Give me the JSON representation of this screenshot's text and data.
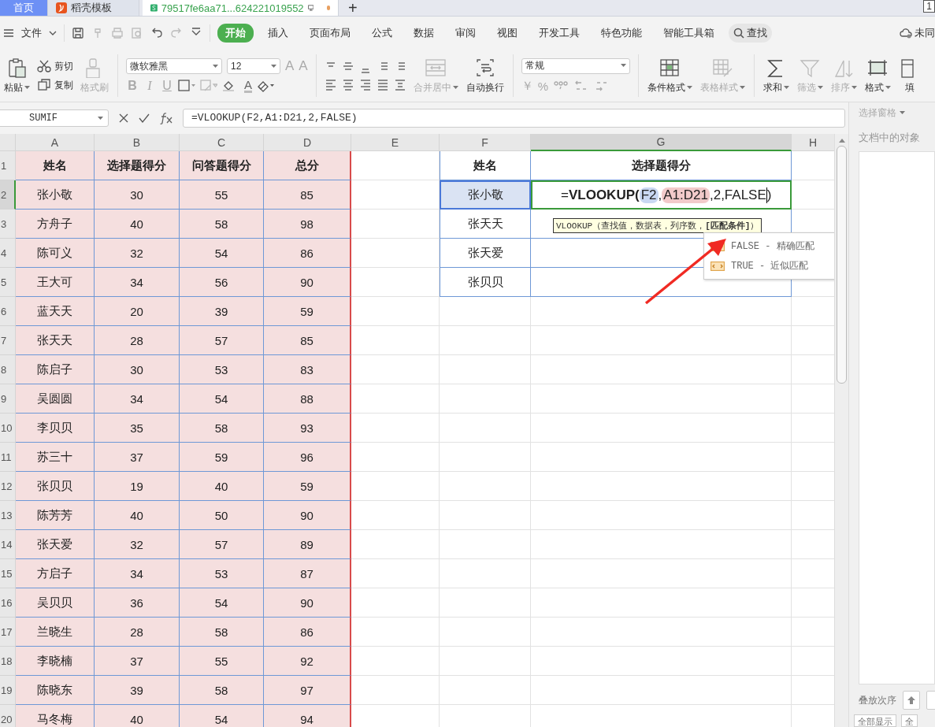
{
  "tabs": [
    {
      "label": "首页",
      "selected": false,
      "kind": "home"
    },
    {
      "label": "稻壳模板",
      "selected": false,
      "kind": "docer"
    },
    {
      "label": "79517fe6aa71...624221019552",
      "selected": true,
      "kind": "sheet",
      "unsaved": true
    }
  ],
  "new_tab": "+",
  "corner_badge": "1",
  "menu": {
    "file": "文件",
    "tabs": [
      {
        "label": "开始",
        "selected": true
      },
      {
        "label": "插入",
        "selected": false
      },
      {
        "label": "页面布局",
        "selected": false
      },
      {
        "label": "公式",
        "selected": false
      },
      {
        "label": "数据",
        "selected": false
      },
      {
        "label": "审阅",
        "selected": false
      },
      {
        "label": "视图",
        "selected": false
      },
      {
        "label": "开发工具",
        "selected": false
      },
      {
        "label": "特色功能",
        "selected": false
      },
      {
        "label": "智能工具箱",
        "selected": false
      }
    ],
    "search": "查找",
    "sync": "未同"
  },
  "ribbon": [
    {
      "kind": "large",
      "label": "粘贴",
      "caret": true,
      "disabled": false
    },
    {
      "kind": "stack",
      "items": [
        {
          "label": "剪切",
          "disabled": false
        },
        {
          "label": "复制",
          "disabled": false
        }
      ]
    },
    {
      "kind": "large",
      "label": "格式刷",
      "caret": false,
      "disabled": true
    },
    {
      "kind": "sep"
    },
    {
      "kind": "font",
      "font": "微软雅黑",
      "size": "12",
      "grow": "A",
      "shrink": "A",
      "styles": [
        "B",
        "I",
        "U"
      ],
      "color_letter": "A"
    },
    {
      "kind": "sep"
    },
    {
      "kind": "align"
    },
    {
      "kind": "large",
      "label": "合并居中",
      "caret": true,
      "disabled": true
    },
    {
      "kind": "large",
      "label": "自动换行",
      "caret": false,
      "disabled": false
    },
    {
      "kind": "sep"
    },
    {
      "kind": "number",
      "format": "常规",
      "currency": "￥",
      "percent": "%"
    },
    {
      "kind": "sep"
    },
    {
      "kind": "large",
      "label": "条件格式",
      "caret": true,
      "disabled": false
    },
    {
      "kind": "large",
      "label": "表格样式",
      "caret": true,
      "disabled": true
    },
    {
      "kind": "sep"
    },
    {
      "kind": "large",
      "label": "求和",
      "caret": true,
      "disabled": false
    },
    {
      "kind": "large",
      "label": "筛选",
      "caret": true,
      "disabled": true
    },
    {
      "kind": "large",
      "label": "排序",
      "caret": true,
      "disabled": true
    },
    {
      "kind": "large",
      "label": "格式",
      "caret": true,
      "disabled": false
    },
    {
      "kind": "large",
      "label": "填",
      "caret": false,
      "disabled": false
    }
  ],
  "formula_bar": {
    "name_box": "SUMIF",
    "formula": "=VLOOKUP(F2,A1:D21,2,FALSE)"
  },
  "columns": [
    {
      "label": "A",
      "selected": false
    },
    {
      "label": "B",
      "selected": false
    },
    {
      "label": "C",
      "selected": false
    },
    {
      "label": "D",
      "selected": false
    },
    {
      "label": "E",
      "selected": false
    },
    {
      "label": "F",
      "selected": false
    },
    {
      "label": "G",
      "selected": true
    },
    {
      "label": "H",
      "selected": false
    }
  ],
  "row_numbers": [
    {
      "label": "1",
      "selected": false
    },
    {
      "label": "2",
      "selected": true
    },
    {
      "label": "3",
      "selected": false
    },
    {
      "label": "4",
      "selected": false
    },
    {
      "label": "5",
      "selected": false
    },
    {
      "label": "6",
      "selected": false
    },
    {
      "label": "7",
      "selected": false
    },
    {
      "label": "8",
      "selected": false
    },
    {
      "label": "9",
      "selected": false
    },
    {
      "label": "10",
      "selected": false
    },
    {
      "label": "11",
      "selected": false
    },
    {
      "label": "12",
      "selected": false
    },
    {
      "label": "13",
      "selected": false
    },
    {
      "label": "14",
      "selected": false
    },
    {
      "label": "15",
      "selected": false
    },
    {
      "label": "16",
      "selected": false
    },
    {
      "label": "17",
      "selected": false
    },
    {
      "label": "18",
      "selected": false
    },
    {
      "label": "19",
      "selected": false
    },
    {
      "label": "20",
      "selected": false
    }
  ],
  "data_table": {
    "header": [
      "姓名",
      "选择题得分",
      "问答题得分",
      "总分"
    ],
    "rows": [
      [
        "张小敬",
        "30",
        "55",
        "85"
      ],
      [
        "方舟子",
        "40",
        "58",
        "98"
      ],
      [
        "陈可义",
        "32",
        "54",
        "86"
      ],
      [
        "王大可",
        "34",
        "56",
        "90"
      ],
      [
        "蓝天天",
        "20",
        "39",
        "59"
      ],
      [
        "张天天",
        "28",
        "57",
        "85"
      ],
      [
        "陈启子",
        "30",
        "53",
        "83"
      ],
      [
        "吴圆圆",
        "34",
        "54",
        "88"
      ],
      [
        "李贝贝",
        "35",
        "58",
        "93"
      ],
      [
        "苏三十",
        "37",
        "59",
        "96"
      ],
      [
        "张贝贝",
        "19",
        "40",
        "59"
      ],
      [
        "陈芳芳",
        "40",
        "50",
        "90"
      ],
      [
        "张天爱",
        "32",
        "57",
        "89"
      ],
      [
        "方启子",
        "34",
        "53",
        "87"
      ],
      [
        "吴贝贝",
        "36",
        "54",
        "90"
      ],
      [
        "兰晓生",
        "28",
        "58",
        "86"
      ],
      [
        "李晓楠",
        "37",
        "55",
        "92"
      ],
      [
        "陈晓东",
        "39",
        "58",
        "97"
      ],
      [
        "马冬梅",
        "40",
        "54",
        "94"
      ]
    ]
  },
  "lookup_table": {
    "header": [
      "姓名",
      "选择题得分"
    ],
    "rows": [
      {
        "name": "张小敬",
        "highlighted": true
      },
      {
        "name": "张天天",
        "highlighted": false
      },
      {
        "name": "张天爱",
        "highlighted": false
      },
      {
        "name": "张贝贝",
        "highlighted": false
      }
    ]
  },
  "editor": {
    "segments": [
      {
        "kind": "plain",
        "text": "="
      },
      {
        "kind": "bold",
        "text": "VLOOKUP("
      },
      {
        "kind": "ref",
        "text": "F2",
        "color": "#c9d8f2"
      },
      {
        "kind": "plain",
        "text": ","
      },
      {
        "kind": "ref",
        "text": "A1:D21",
        "color": "#f2caca"
      },
      {
        "kind": "plain",
        "text": ",2,FALSE"
      },
      {
        "kind": "cursor"
      },
      {
        "kind": "plain",
        "text": ")"
      }
    ]
  },
  "tooltip": "VLOOKUP（查找值，数据表，列序数，**[匹配条件]**）",
  "suggestions": [
    {
      "label": "FALSE - 精确匹配"
    },
    {
      "label": "TRUE - 近似匹配"
    }
  ],
  "side_panel": {
    "title": "选择窗格",
    "section": "文档中的对象",
    "order_label": "叠放次序",
    "buttons": [
      "全部显示",
      "全"
    ]
  }
}
